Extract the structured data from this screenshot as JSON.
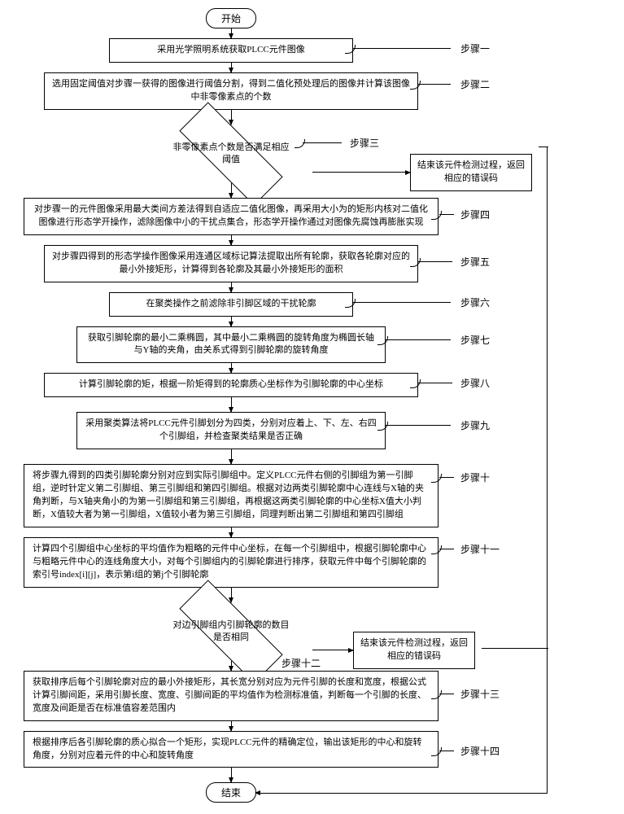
{
  "terminals": {
    "start": "开始",
    "end": "结束"
  },
  "steps": {
    "s1": {
      "label": "步骤一",
      "text": "采用光学照明系统获取PLCC元件图像"
    },
    "s2": {
      "label": "步骤二",
      "text": "选用固定阈值对步骤一获得的图像进行阈值分割，得到二值化预处理后的图像并计算该图像中非零像素点的个数"
    },
    "s3": {
      "label": "步骤三",
      "text": "非零像素点个数是否满足相应阈值"
    },
    "s4": {
      "label": "步骤四",
      "text": "对步骤一的元件图像采用最大类间方差法得到自适应二值化图像，再采用大小为的矩形内核对二值化图像进行形态学开操作，滤除图像中小的干扰点集合，形态学开操作通过对图像先腐蚀再膨胀实现"
    },
    "s5": {
      "label": "步骤五",
      "text": "对步骤四得到的形态学操作图像采用连通区域标记算法提取出所有轮廓，获取各轮廓对应的最小外接矩形，计算得到各轮廓及其最小外接矩形的面积"
    },
    "s6": {
      "label": "步骤六",
      "text": "在聚类操作之前滤除非引脚区域的干扰轮廓"
    },
    "s7": {
      "label": "步骤七",
      "text": "获取引脚轮廓的最小二乘椭圆，其中最小二乘椭圆的旋转角度为椭圆长轴与Y轴的夹角，由关系式得到引脚轮廓的旋转角度"
    },
    "s8": {
      "label": "步骤八",
      "text": "计算引脚轮廓的矩，根据一阶矩得到的轮廓质心坐标作为引脚轮廓的中心坐标"
    },
    "s9": {
      "label": "步骤九",
      "text": "采用聚类算法将PLCC元件引脚划分为四类，分别对应着上、下、左、右四个引脚组，并检查聚类结果是否正确"
    },
    "s10": {
      "label": "步骤十",
      "text": "将步骤九得到的四类引脚轮廓分别对应到实际引脚组中。定义PLCC元件右侧的引脚组为第一引脚组，逆时针定义第二引脚组、第三引脚组和第四引脚组。根据对边两类引脚轮廓中心连线与X轴的夹角判断，与X轴夹角小的为第一引脚组和第三引脚组，再根据这两类引脚轮廓的中心坐标X值大小判断，X值较大者为第一引脚组，X值较小者为第三引脚组，同理判断出第二引脚组和第四引脚组"
    },
    "s11": {
      "label": "步骤十一",
      "text": "计算四个引脚组中心坐标的平均值作为粗略的元件中心坐标，在每一个引脚组中，根据引脚轮廓中心与粗略元件中心的连线角度大小，对每个引脚组内的引脚轮廓进行排序，获取元件中每个引脚轮廓的索引号index[i][j]，表示第i组的第j个引脚轮廓"
    },
    "s12": {
      "label": "步骤十二",
      "text": "对边引脚组内引脚轮廓的数目是否相同"
    },
    "s13": {
      "label": "步骤十三",
      "text": "获取排序后每个引脚轮廓对应的最小外接矩形，其长宽分别对应为元件引脚的长度和宽度，根据公式计算引脚间距，采用引脚长度、宽度、引脚间距的平均值作为检测标准值，判断每一个引脚的长度、宽度及间距是否在标准值容差范围内"
    },
    "s14": {
      "label": "步骤十四",
      "text": "根据排序后各引脚轮廓的质心拟合一个矩形，实现PLCC元件的精确定位，输出该矩形的中心和旋转角度，分别对应着元件的中心和旋转角度"
    }
  },
  "errors": {
    "e1": "结束该元件检测过程，返回相应的错误码",
    "e2": "结束该元件检测过程，返回相应的错误码"
  }
}
